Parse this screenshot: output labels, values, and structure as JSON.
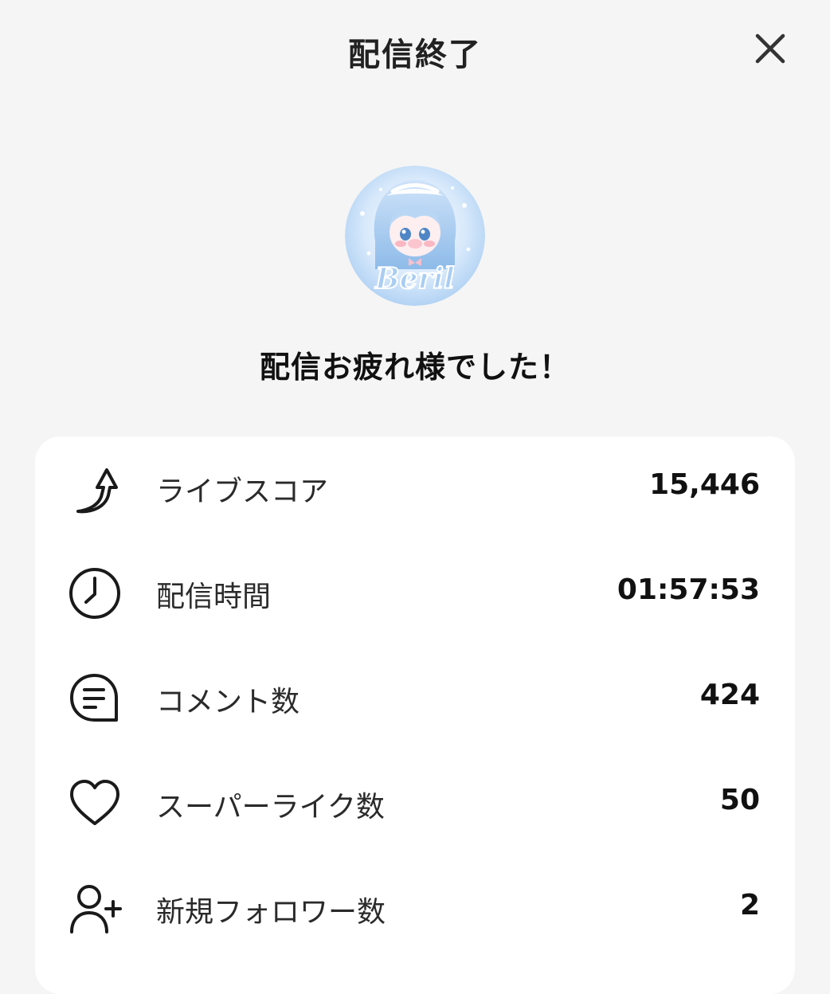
{
  "header": {
    "title": "配信終了",
    "close_icon": "close-icon"
  },
  "avatar": {
    "text": "Beril"
  },
  "subtitle": "配信お疲れ様でした！",
  "stats": [
    {
      "icon": "arrow-up-icon",
      "label": "ライブスコア",
      "value": "15,446"
    },
    {
      "icon": "clock-icon",
      "label": "配信時間",
      "value": "01:57:53"
    },
    {
      "icon": "comment-icon",
      "label": "コメント数",
      "value": "424"
    },
    {
      "icon": "heart-icon",
      "label": "スーパーライク数",
      "value": "50"
    },
    {
      "icon": "add-user-icon",
      "label": "新規フォロワー数",
      "value": "2"
    }
  ]
}
